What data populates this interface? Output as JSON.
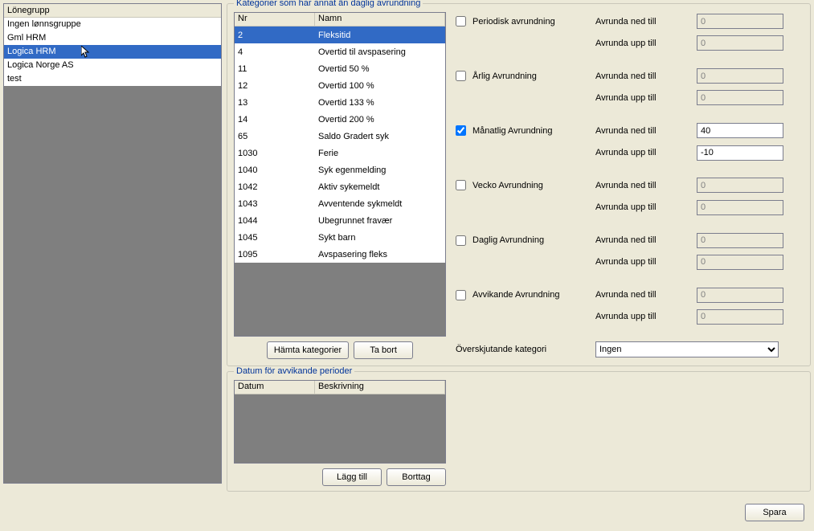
{
  "left_list": {
    "header": "Lönegrupp",
    "items": [
      {
        "label": "Ingen lønnsgruppe",
        "selected": false
      },
      {
        "label": "Gml HRM",
        "selected": false
      },
      {
        "label": "Logica HRM",
        "selected": true,
        "cursor": true
      },
      {
        "label": "Logica Norge AS",
        "selected": false
      },
      {
        "label": "test",
        "selected": false
      }
    ]
  },
  "group1": {
    "title": "Kategorier som har annat än daglig avrundning",
    "cols": {
      "nr": "Nr",
      "namn": "Namn"
    },
    "rows": [
      {
        "nr": "2",
        "namn": "Fleksitid",
        "selected": true
      },
      {
        "nr": "4",
        "namn": "Overtid til avspasering"
      },
      {
        "nr": "11",
        "namn": "Overtid 50 %"
      },
      {
        "nr": "12",
        "namn": "Overtid 100 %"
      },
      {
        "nr": "13",
        "namn": "Overtid 133 %"
      },
      {
        "nr": "14",
        "namn": "Overtid 200 %"
      },
      {
        "nr": "65",
        "namn": "Saldo Gradert syk"
      },
      {
        "nr": "1030",
        "namn": "Ferie"
      },
      {
        "nr": "1040",
        "namn": "Syk egenmelding"
      },
      {
        "nr": "1042",
        "namn": "Aktiv sykemeldt"
      },
      {
        "nr": "1043",
        "namn": "Avventende sykmeldt"
      },
      {
        "nr": "1044",
        "namn": "Ubegrunnet fravær"
      },
      {
        "nr": "1045",
        "namn": "Sykt barn"
      },
      {
        "nr": "1095",
        "namn": "Avspasering fleks"
      }
    ],
    "buttons": {
      "fetch": "Hämta kategorier",
      "remove": "Ta bort"
    }
  },
  "settings": {
    "rows": [
      {
        "chk_label": "Periodisk avrundning",
        "checked": false,
        "ned_label": "Avrunda ned till",
        "ned_val": "0",
        "ned_disabled": true,
        "upp_label": "Avrunda upp till",
        "upp_val": "0",
        "upp_disabled": true
      },
      {
        "chk_label": "Årlig Avrundning",
        "checked": false,
        "ned_label": "Avrunda ned till",
        "ned_val": "0",
        "ned_disabled": true,
        "upp_label": "Avrunda upp till",
        "upp_val": "0",
        "upp_disabled": true
      },
      {
        "chk_label": "Månatlig Avrundning",
        "checked": true,
        "ned_label": "Avrunda ned till",
        "ned_val": "40",
        "ned_disabled": false,
        "upp_label": "Avrunda upp till",
        "upp_val": "-10",
        "upp_disabled": false
      },
      {
        "chk_label": "Vecko Avrundning",
        "checked": false,
        "ned_label": "Avrunda ned till",
        "ned_val": "0",
        "ned_disabled": true,
        "upp_label": "Avrunda upp till",
        "upp_val": "0",
        "upp_disabled": true
      },
      {
        "chk_label": "Daglig Avrundning",
        "checked": false,
        "ned_label": "Avrunda ned till",
        "ned_val": "0",
        "ned_disabled": true,
        "upp_label": "Avrunda upp till",
        "upp_val": "0",
        "upp_disabled": true
      },
      {
        "chk_label": "Avvikande Avrundning",
        "checked": false,
        "ned_label": "Avrunda ned till",
        "ned_val": "0",
        "ned_disabled": true,
        "upp_label": "Avrunda upp till",
        "upp_val": "0",
        "upp_disabled": true
      }
    ],
    "overflow_label": "Överskjutande kategori",
    "overflow_value": "Ingen"
  },
  "group2": {
    "title": "Datum för avvikande perioder",
    "cols": {
      "datum": "Datum",
      "besk": "Beskrivning"
    },
    "buttons": {
      "add": "Lägg till",
      "del": "Borttag"
    }
  },
  "save_button": "Spara"
}
